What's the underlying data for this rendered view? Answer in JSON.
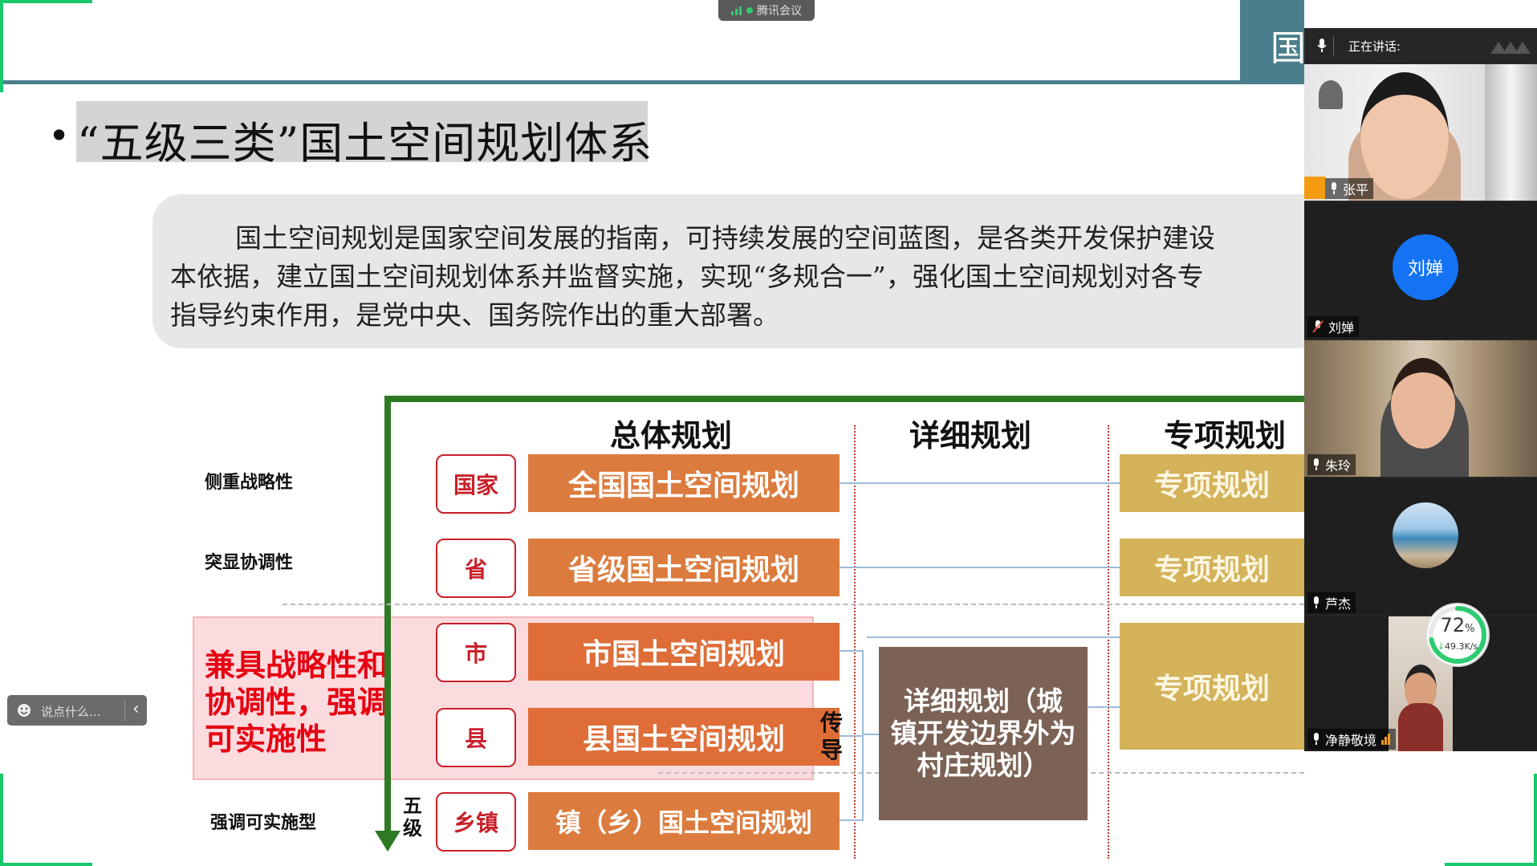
{
  "slide": {
    "header_char": "国",
    "bullet": "•",
    "title": "“五级三类”国土空间规划体系",
    "intro_lines": [
      "国土空间规划是国家空间发展的指南，可持续发展的空间蓝图，是各类开发保护建设",
      "本依据，建立国土空间规划体系并监督实施，实现“多规合一”，强化国土空间规划对各专",
      "指导约束作用，是党中央、国务院作出的重大部署。"
    ],
    "columns": {
      "overall": "总体规划",
      "detailed": "详细规划",
      "special": "专项规划"
    },
    "side_labels": {
      "strategic": "侧重战略性",
      "coordination": "突显协调性",
      "implement": "强调可实施型"
    },
    "emphasis_lines": [
      "兼具战略性和",
      "协调性，强调",
      "可实施性"
    ],
    "levels": [
      "国家",
      "省",
      "市",
      "县",
      "乡镇"
    ],
    "plans": [
      "全国国土空间规划",
      "省级国土空间规划",
      "市国土空间规划",
      "县国土空间规划",
      "镇（乡）国土空间规划"
    ],
    "special_boxes": [
      "专项规划",
      "专项规划",
      "专项规划"
    ],
    "detail_lines": [
      "详细规划（城",
      "镇开发边界外为",
      "村庄规划）"
    ],
    "guide_chars": [
      "传",
      "导"
    ],
    "five_level_chars": [
      "五",
      "级"
    ]
  },
  "meeting": {
    "app_name": "腾讯会议",
    "speaking_label": "正在讲话:",
    "chat_placeholder": "说点什么...",
    "chat_collapse": "‹",
    "network": {
      "percent": "72",
      "percent_unit": "%",
      "speed": "49.3K/s"
    },
    "participants": [
      {
        "name": "张平"
      },
      {
        "name": "刘婵",
        "avatar_text": "刘婵"
      },
      {
        "name": "朱玲"
      },
      {
        "name": "芦杰"
      },
      {
        "name": "净静敬境"
      }
    ]
  }
}
